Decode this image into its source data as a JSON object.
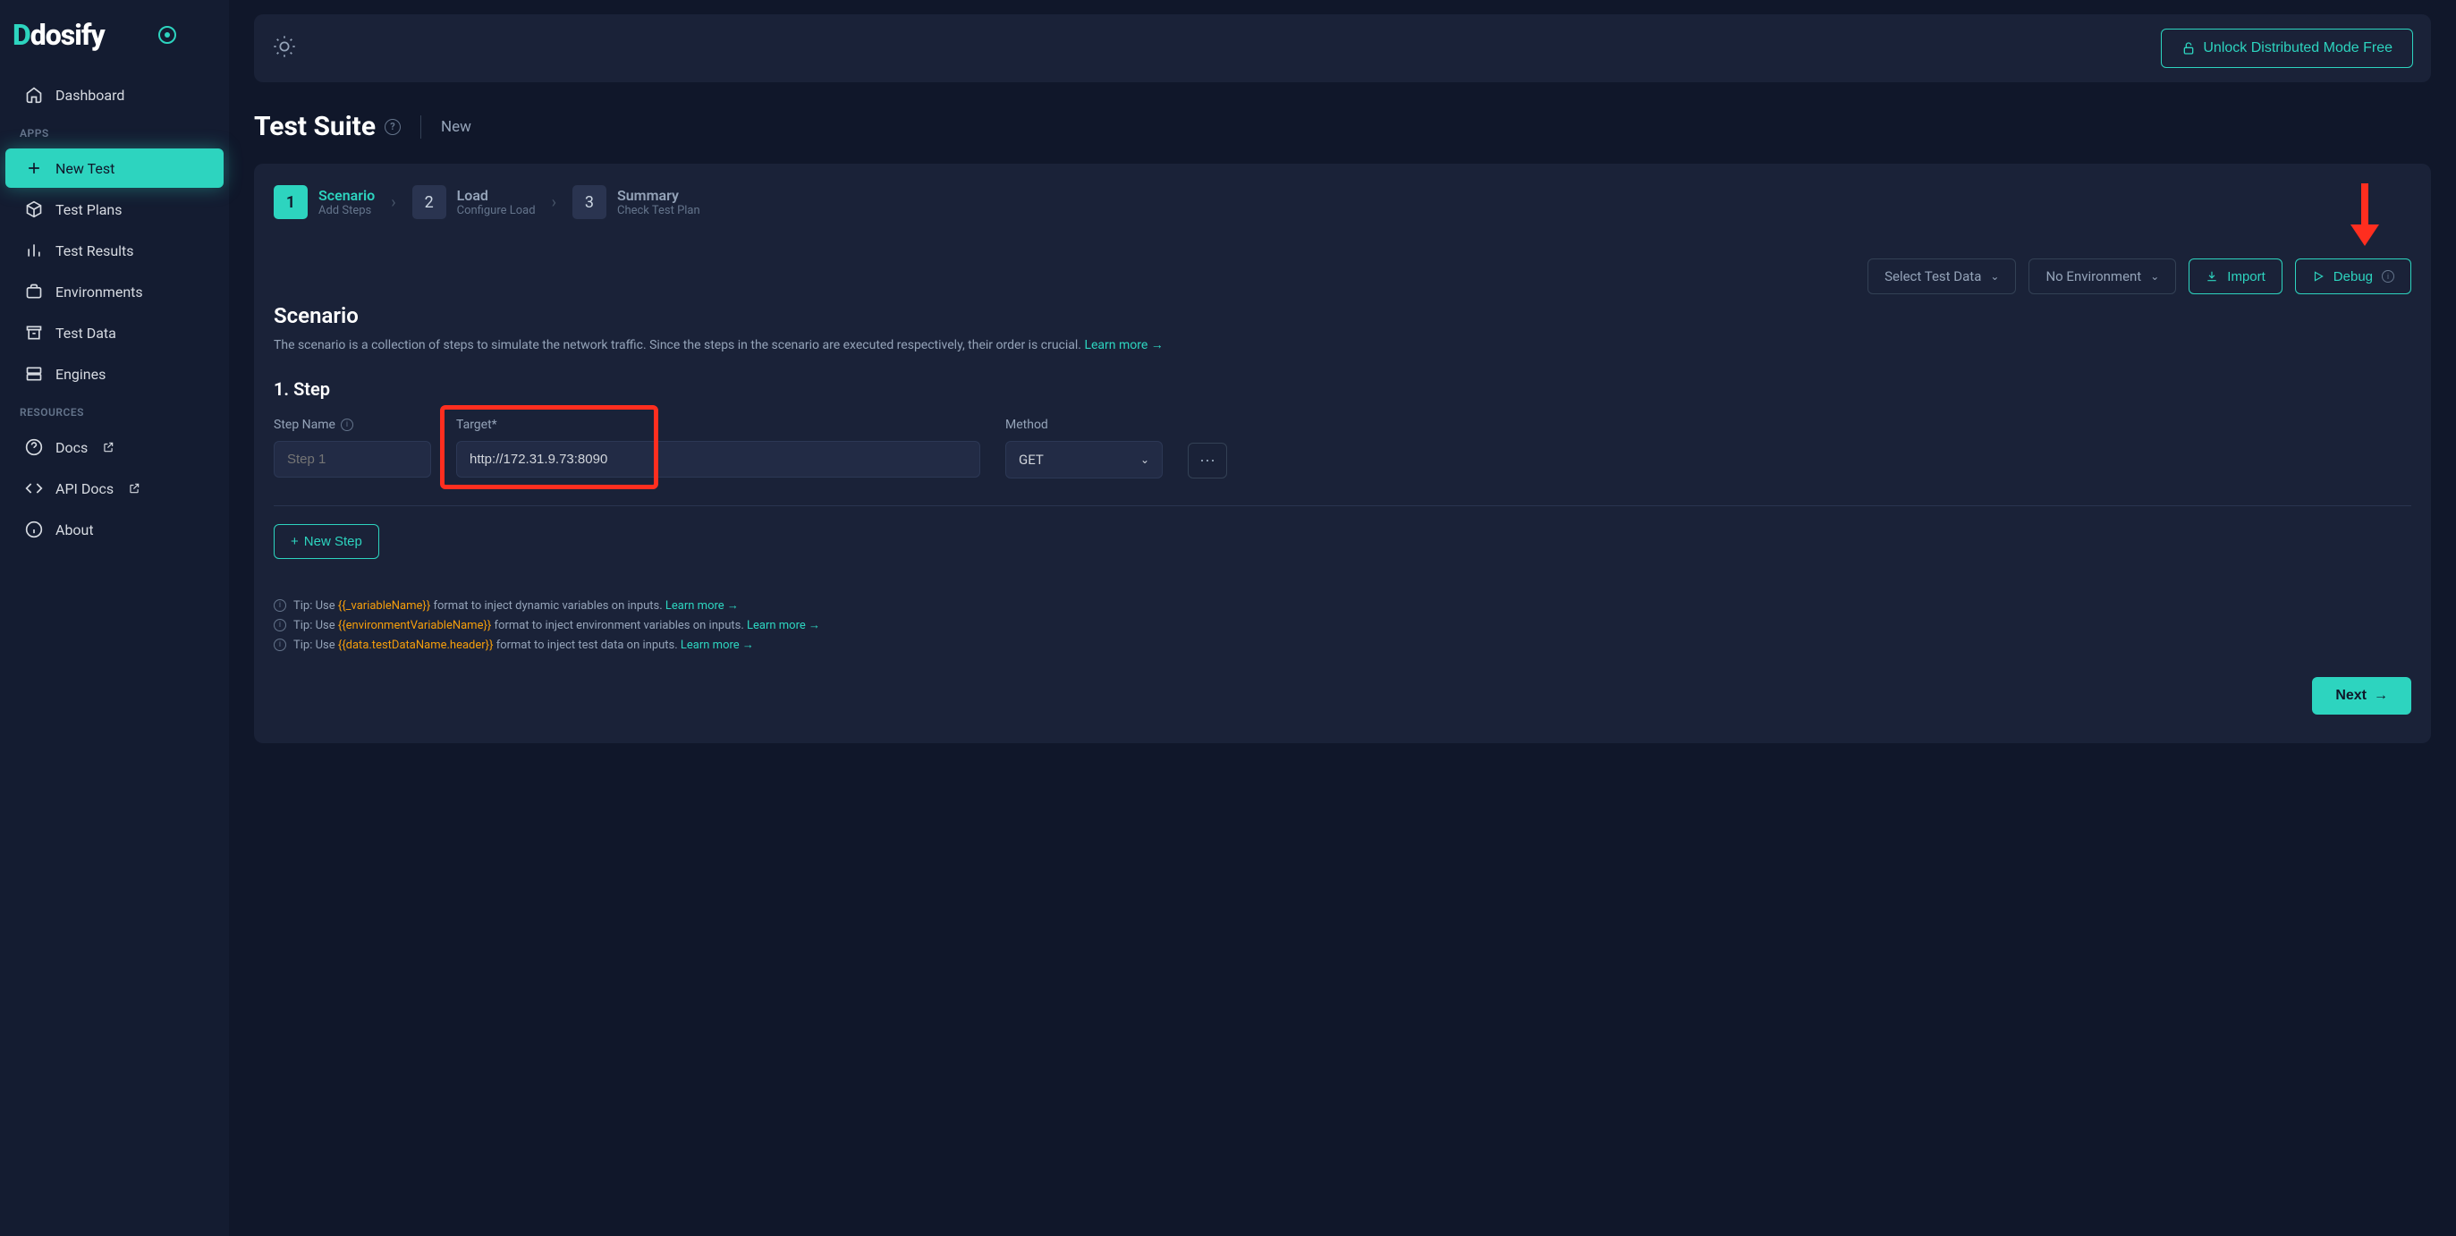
{
  "brand": {
    "name": "Ddosify"
  },
  "sidebar": {
    "dashboard": "Dashboard",
    "sections": {
      "apps": "APPS",
      "resources": "RESOURCES"
    },
    "apps": {
      "newTest": "New Test",
      "testPlans": "Test Plans",
      "testResults": "Test Results",
      "environments": "Environments",
      "testData": "Test Data",
      "engines": "Engines"
    },
    "resources": {
      "docs": "Docs",
      "apiDocs": "API Docs",
      "about": "About"
    }
  },
  "topbar": {
    "unlock": "Unlock Distributed Mode Free"
  },
  "page": {
    "title": "Test Suite",
    "subtitle": "New"
  },
  "stepper": {
    "s1": {
      "num": "1",
      "title": "Scenario",
      "sub": "Add Steps"
    },
    "s2": {
      "num": "2",
      "title": "Load",
      "sub": "Configure Load"
    },
    "s3": {
      "num": "3",
      "title": "Summary",
      "sub": "Check Test Plan"
    }
  },
  "toolbar": {
    "selectTestData": "Select Test Data",
    "noEnvironment": "No Environment",
    "import": "Import",
    "debug": "Debug"
  },
  "scenario": {
    "title": "Scenario",
    "desc": "The scenario is a collection of steps to simulate the network traffic. Since the steps in the scenario are executed respectively, their order is crucial. ",
    "learnMore": "Learn more →"
  },
  "step": {
    "heading": "1. Step",
    "labels": {
      "stepName": "Step Name",
      "target": "Target*",
      "method": "Method"
    },
    "values": {
      "stepNamePlaceholder": "Step 1",
      "target": "http://172.31.9.73:8090",
      "method": "GET"
    },
    "newStep": "New Step"
  },
  "tips": {
    "prefix": "Tip: Use ",
    "t1": {
      "code": "{{_variableName}}",
      "suffix": " format to inject dynamic variables on inputs. "
    },
    "t2": {
      "code": "{{environmentVariableName}}",
      "suffix": " format to inject environment variables on inputs. "
    },
    "t3": {
      "code": "{{data.testDataName.header}}",
      "suffix": " format to inject test data on inputs. "
    },
    "learnMore": "Learn more →"
  },
  "footer": {
    "next": "Next"
  }
}
